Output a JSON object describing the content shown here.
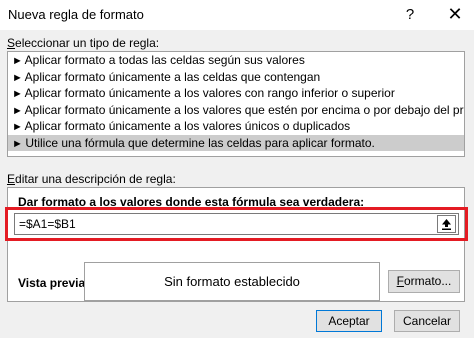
{
  "dialog": {
    "title": "Nueva regla de formato",
    "help": "?",
    "close": "✕"
  },
  "rule_type": {
    "label_first": "S",
    "label_rest": "eleccionar un tipo de regla:",
    "items": [
      {
        "label": "Aplicar formato a todas las celdas según sus valores"
      },
      {
        "label": "Aplicar formato únicamente a las celdas que contengan"
      },
      {
        "label": "Aplicar formato únicamente a los valores con rango inferior o superior"
      },
      {
        "label": "Aplicar formato únicamente a los valores que estén por encima o por debajo del promedio"
      },
      {
        "label": "Aplicar formato únicamente a los valores únicos o duplicados"
      },
      {
        "label": "Utilice una fórmula que determine las celdas para aplicar formato."
      }
    ],
    "selected_index": 5,
    "arrow": "►"
  },
  "description": {
    "label_first": "E",
    "label_rest": "ditar una descripción de regla:",
    "formula_label_pre": "Dar f",
    "formula_label_ul": "o",
    "formula_label_post": "rmato a los valores donde esta fórmula sea verdadera:",
    "formula_value": "=$A1=$B1",
    "preview_label": "Vista previa:",
    "preview_text": "Sin formato establecido",
    "format_button_ul": "F",
    "format_button_rest": "ormato..."
  },
  "buttons": {
    "ok": "Aceptar",
    "cancel": "Cancelar"
  },
  "colors": {
    "highlight_outline": "#e41b23",
    "selected_row": "#cccccc"
  }
}
